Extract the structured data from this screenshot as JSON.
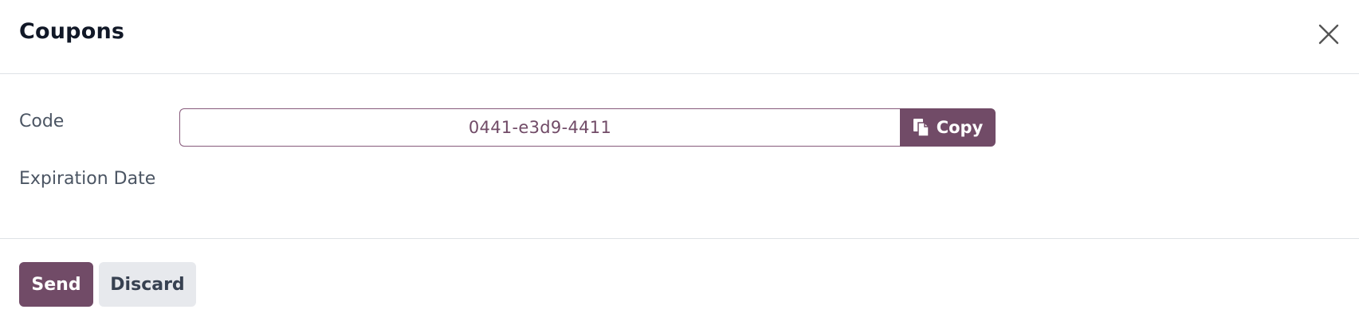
{
  "dialog": {
    "title": "Coupons",
    "close_icon": "close-icon"
  },
  "form": {
    "code_label": "Code",
    "code_value": "0441-e3d9-4411",
    "copy_label": "Copy",
    "copy_icon": "clipboard-icon",
    "expiration_label": "Expiration Date",
    "expiration_value": ""
  },
  "footer": {
    "send_label": "Send",
    "discard_label": "Discard"
  },
  "colors": {
    "primary": "#714b67",
    "secondary": "#e7e9ed",
    "border": "#dee2e6"
  }
}
